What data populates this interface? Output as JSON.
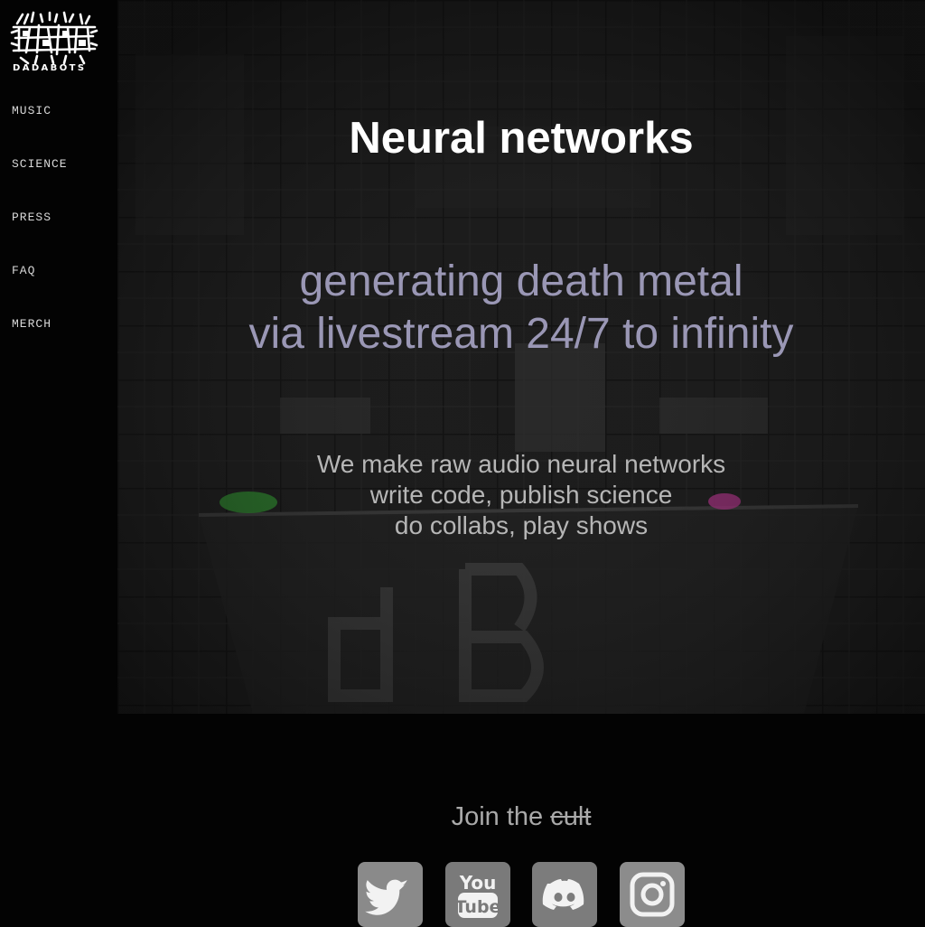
{
  "brand": {
    "logo_text": "DADABOTS",
    "icon": "dadabots-logo"
  },
  "nav": {
    "items": [
      {
        "label": "MUSIC"
      },
      {
        "label": "SCIENCE"
      },
      {
        "label": "PRESS"
      },
      {
        "label": "FAQ"
      },
      {
        "label": "MERCH"
      }
    ]
  },
  "hero": {
    "title": "Neural networks",
    "tagline": [
      "generating death metal",
      "via livestream 24/7 to infinity"
    ],
    "description": [
      "We make raw audio neural networks",
      "write code, publish science",
      "do collabs, play shows"
    ]
  },
  "footer": {
    "join_prefix": "Join the",
    "join_struck": "cult",
    "social": [
      {
        "icon": "twitter-icon"
      },
      {
        "icon": "youtube-icon"
      },
      {
        "icon": "discord-icon"
      },
      {
        "icon": "instagram-icon"
      }
    ]
  },
  "colors": {
    "background": "#030303",
    "tagline": "#9a97b5",
    "description": "#b6b6b6",
    "accent_green": "#2e8b2e",
    "accent_pink": "#b0338a"
  }
}
